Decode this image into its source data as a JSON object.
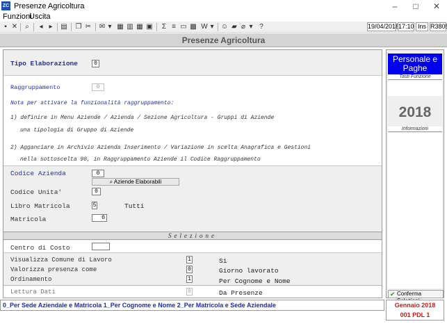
{
  "window": {
    "title": "Presenze Agricoltura",
    "app_icon": "app-logo-icon"
  },
  "menu": {
    "items": [
      "Funzioni",
      "Uscita"
    ]
  },
  "toolbar": {
    "date": "19/04/2018",
    "time": "17:10",
    "ins": "Ins",
    "code": "R3805"
  },
  "header": {
    "title": "Presenze Agricoltura"
  },
  "form": {
    "tipo_elaborazione": {
      "label": "Tipo Elaborazione",
      "value": "0"
    },
    "raggruppamento": {
      "label": "Raggruppamento",
      "value": "0"
    },
    "notes": [
      "Nota per attivare la funzionalità raggruppamento:",
      "1) definire in Menu Aziende / Azienda / Sezione Agricoltura  - Gruppi di Aziende",
      "una tipologia di Gruppo di Aziende",
      "2) Agganciare in Archivio Azienda Inserimento / Variazione  in scelta Anagrafica e Gestioni",
      "nella sottoscelta 98, in Raggruppamento Aziende  il Codice Raggruppamento"
    ],
    "codice_azienda": {
      "label": "Codice Azienda",
      "value": "0"
    },
    "aziende_button": "Aziende Elaborabili",
    "codice_unita": {
      "label": "Codice Unita'",
      "value": "0"
    },
    "libro_matricola": {
      "label": "Libro Matricola",
      "value": "5",
      "desc": "Tutti"
    },
    "matricola": {
      "label": "Matricola",
      "value": "0"
    },
    "selezione_title": "Selezione",
    "centro_di_costo": {
      "label": "Centro di Costo",
      "value": ""
    },
    "visualizza_comune": {
      "label": "Visualizza Comune di Lavoro",
      "value": "1",
      "desc": "Si"
    },
    "valorizza_presenza": {
      "label": "Valorizza presenza come",
      "value": "0",
      "desc": "Giorno lavorato"
    },
    "ordinamento": {
      "label": "Ordinamento",
      "value": "1",
      "desc": "Per Cognome e Nome"
    },
    "lettura_dati": {
      "label": "Lettura Dati",
      "value": "0",
      "desc": "Da Presenze"
    }
  },
  "side": {
    "product": "Personale e Paghe",
    "tasti_funzione": "Tasti Funzione",
    "year": "2018",
    "informazioni": "Informazioni",
    "conferma": "Conferma Selezioni"
  },
  "footer": {
    "options": "0_Per Sede Aziendale e Matricola  1_Per Cognome e Nome  2_Per Matricola e Sede Aziendale",
    "period": "Gennaio  2018",
    "pdl": "001 PDL 1"
  },
  "colors": {
    "accent_blue": "#1a2fb0",
    "brand_blue": "#0000ee",
    "footer_red": "#c02020"
  }
}
